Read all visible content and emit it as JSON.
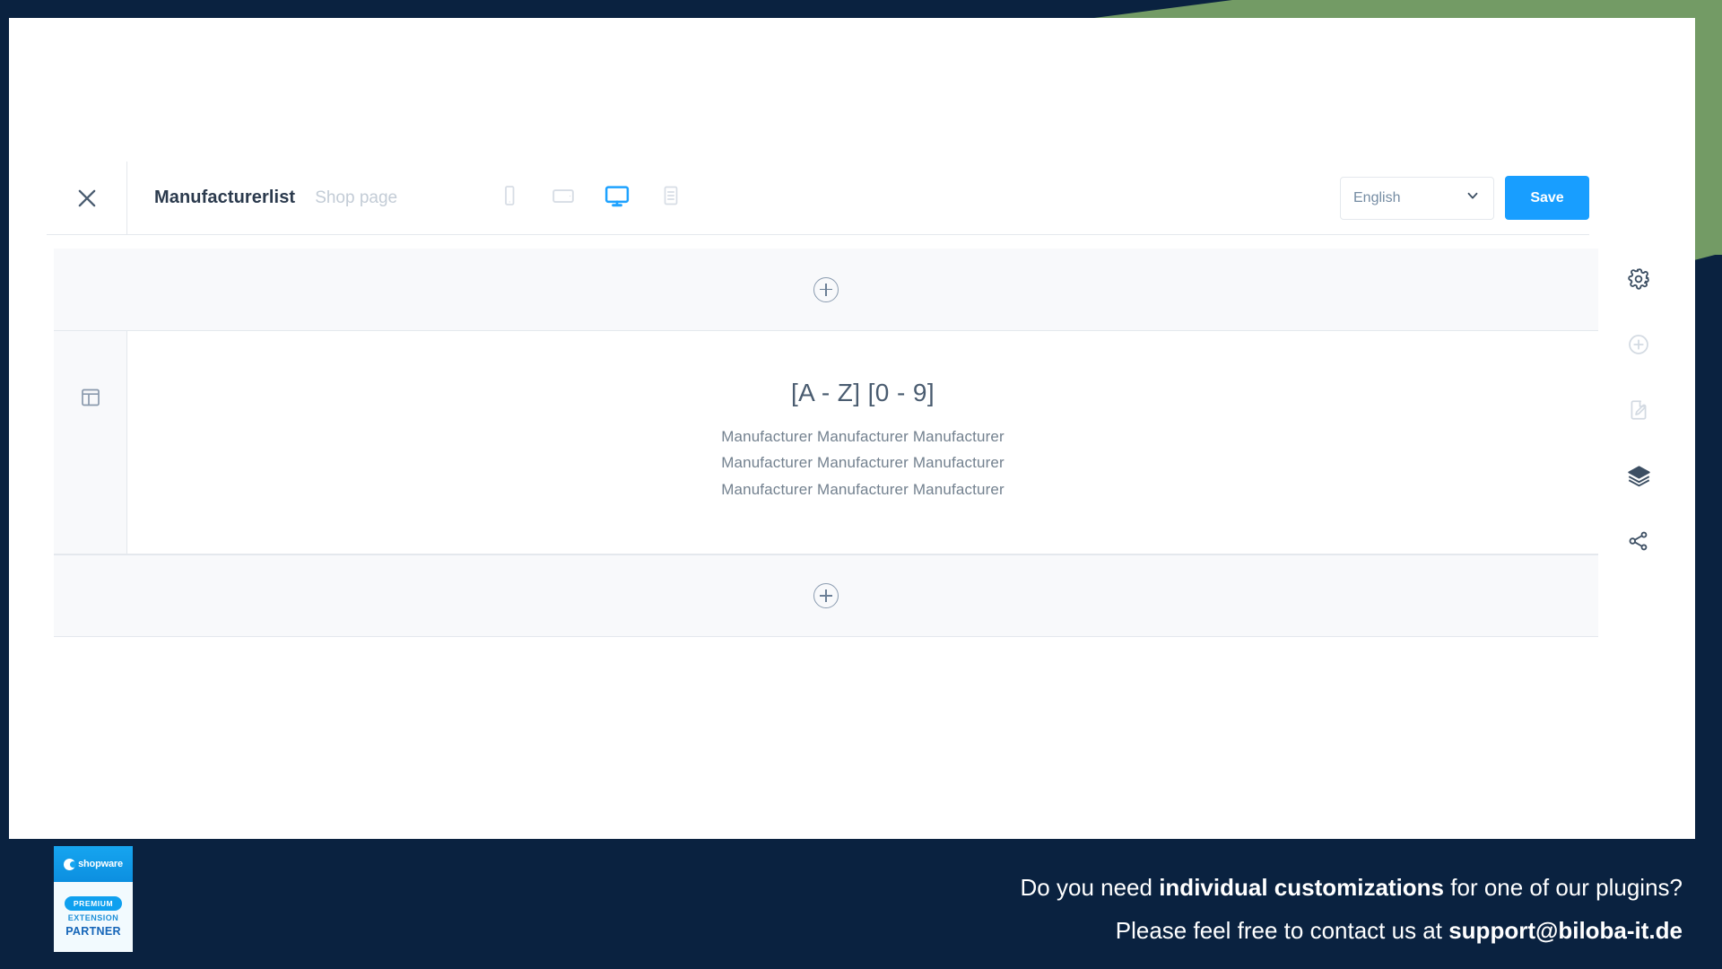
{
  "window": {
    "accent_navy": "#0a2240",
    "accent_green": "#739b65",
    "accent_blue": "#189eff"
  },
  "toolbar": {
    "close_icon": "close-icon",
    "title": "Manufacturerlist",
    "subtitle": "Shop page",
    "devices": [
      {
        "name": "mobile-view",
        "icon": "mobile-icon",
        "active": false
      },
      {
        "name": "tablet-view",
        "icon": "tablet-icon",
        "active": false
      },
      {
        "name": "desktop-view",
        "icon": "desktop-icon",
        "active": true
      },
      {
        "name": "form-view",
        "icon": "list-icon",
        "active": false
      }
    ],
    "language": {
      "value": "English",
      "chevron_icon": "chevron-down-icon"
    },
    "save_label": "Save"
  },
  "stage": {
    "add_section_top_icon": "plus-circle-icon",
    "add_section_bottom_icon": "plus-circle-icon",
    "section_icon": "layout-icon",
    "block": {
      "heading": "[A - Z] [0 - 9]",
      "rows": [
        "Manufacturer Manufacturer Manufacturer",
        "Manufacturer Manufacturer Manufacturer",
        "Manufacturer Manufacturer Manufacturer"
      ]
    }
  },
  "right_rail": {
    "items": [
      {
        "name": "settings-button",
        "icon": "gear-icon",
        "enabled": true
      },
      {
        "name": "add-button",
        "icon": "plus-circle-icon",
        "enabled": false
      },
      {
        "name": "edit-page-button",
        "icon": "page-edit-icon",
        "enabled": false
      },
      {
        "name": "layers-button",
        "icon": "layers-icon",
        "enabled": true
      },
      {
        "name": "share-button",
        "icon": "share-icon",
        "enabled": true
      }
    ]
  },
  "banner": {
    "badge": {
      "wordmark": "shopware",
      "pill": "PREMIUM",
      "line2": "EXTENSION",
      "line3": "PARTNER"
    },
    "line1_pre": "Do you need ",
    "line1_bold": "individual customizations",
    "line1_post": " for one of our plugins?",
    "line2_pre": "Please feel free to contact us at ",
    "line2_bold": "support@biloba-it.de"
  }
}
